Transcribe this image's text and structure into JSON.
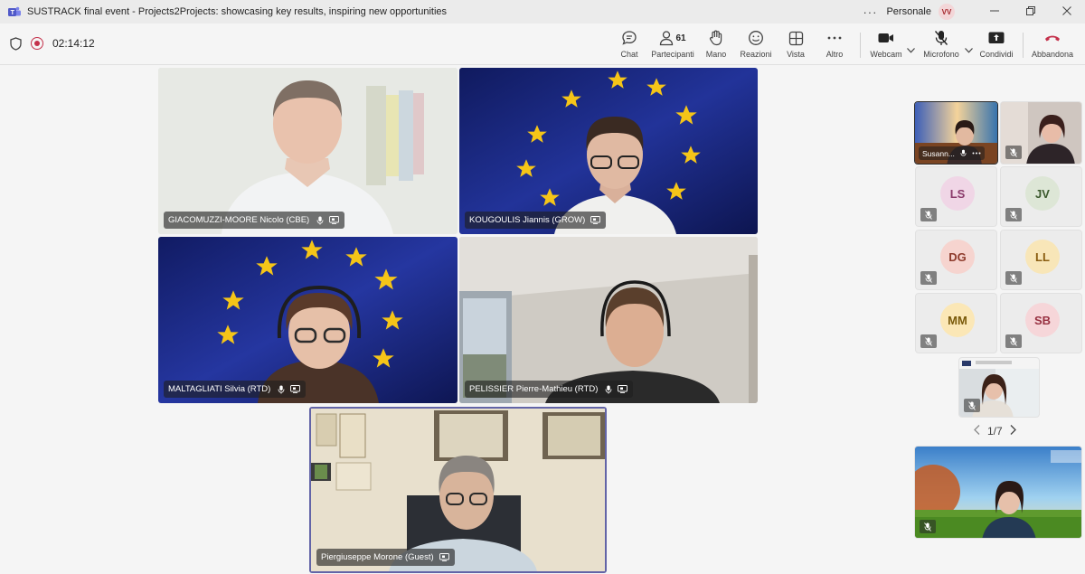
{
  "window": {
    "title": "SUSTRACK final event - Projects2Projects: showcasing key results, inspiring new opportunities",
    "profile_label": "Personale",
    "avatar_initials": "VV"
  },
  "toolbar": {
    "timer": "02:14:12",
    "chat": "Chat",
    "participants_count": "61",
    "participants": "Partecipanti",
    "hand": "Mano",
    "reactions": "Reazioni",
    "view": "Vista",
    "more": "Altro",
    "camera": "Webcam",
    "mic": "Microfono",
    "share": "Condividi",
    "leave": "Abbandona"
  },
  "stage": {
    "tiles": [
      {
        "name": "GIACOMUZZI-MOORE Nicolo (CBE)"
      },
      {
        "name": "KOUGOULIS Jiannis (GROW)"
      },
      {
        "name": "MALTAGLIATI Silvia (RTD)"
      },
      {
        "name": "PELISSIER Pierre-Mathieu (RTD)"
      },
      {
        "name": "Piergiuseppe Morone (Guest)"
      }
    ]
  },
  "gallery": {
    "self_label": "Susann...",
    "initials": [
      {
        "text": "LS",
        "bg": "#f0d6e6",
        "fg": "#8a3a6b"
      },
      {
        "text": "JV",
        "bg": "#dde6d6",
        "fg": "#3c5a2e"
      },
      {
        "text": "DG",
        "bg": "#f6d4cf",
        "fg": "#8e3b2c"
      },
      {
        "text": "LL",
        "bg": "#f8e6b8",
        "fg": "#8a5d10"
      },
      {
        "text": "MM",
        "bg": "#fbe7b6",
        "fg": "#7a5a0a"
      },
      {
        "text": "SB",
        "bg": "#f6d6d9",
        "fg": "#973040"
      }
    ],
    "pager": "1/7"
  },
  "colors": {
    "leave": "#c4314b",
    "active_border": "#6264a7",
    "eu_blue": "#1c2a8c",
    "eu_star": "#f5c518"
  }
}
